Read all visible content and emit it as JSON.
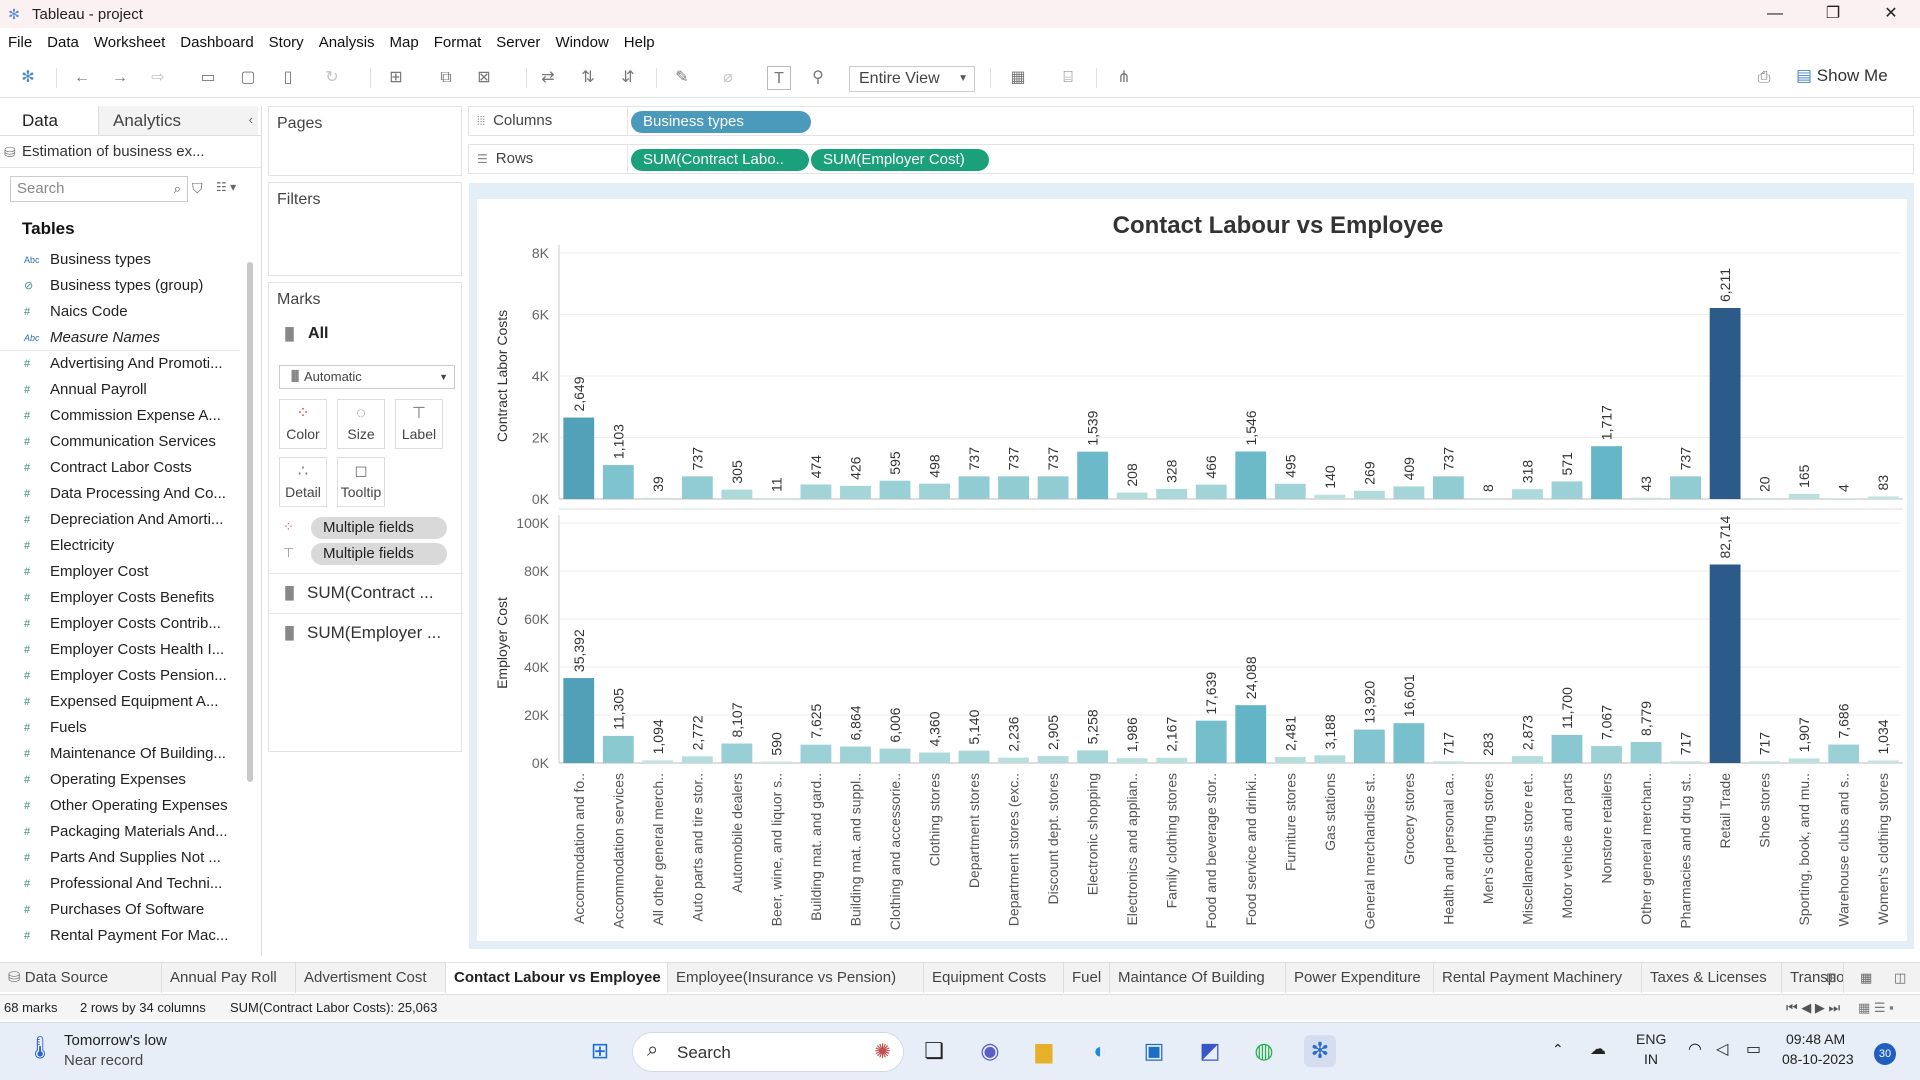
{
  "window": {
    "title": "Tableau - project"
  },
  "menu": [
    "File",
    "Data",
    "Worksheet",
    "Dashboard",
    "Story",
    "Analysis",
    "Map",
    "Format",
    "Server",
    "Window",
    "Help"
  ],
  "toolbar": {
    "fit": "Entire View",
    "show_me": "Show Me"
  },
  "left": {
    "tabs": [
      "Data",
      "Analytics"
    ],
    "datasource": "Estimation of business ex...",
    "search_placeholder": "Search",
    "tables_header": "Tables",
    "fields": [
      {
        "name": "Business types",
        "type": "abc"
      },
      {
        "name": "Business types (group)",
        "type": "group"
      },
      {
        "name": "Naics Code",
        "type": "num"
      },
      {
        "name": "Measure Names",
        "type": "abc",
        "italic": true
      },
      {
        "name": "Advertising And Promoti...",
        "type": "num"
      },
      {
        "name": "Annual Payroll",
        "type": "num"
      },
      {
        "name": "Commission Expense A...",
        "type": "num"
      },
      {
        "name": "Communication Services",
        "type": "num"
      },
      {
        "name": "Contract Labor Costs",
        "type": "num"
      },
      {
        "name": "Data Processing And Co...",
        "type": "num"
      },
      {
        "name": "Depreciation And Amorti...",
        "type": "num"
      },
      {
        "name": "Electricity",
        "type": "num"
      },
      {
        "name": "Employer Cost",
        "type": "num"
      },
      {
        "name": "Employer Costs Benefits",
        "type": "num"
      },
      {
        "name": "Employer Costs Contrib...",
        "type": "num"
      },
      {
        "name": "Employer Costs Health I...",
        "type": "num"
      },
      {
        "name": "Employer Costs Pension...",
        "type": "num"
      },
      {
        "name": "Expensed Equipment A...",
        "type": "num"
      },
      {
        "name": "Fuels",
        "type": "num"
      },
      {
        "name": "Maintenance Of Building...",
        "type": "num"
      },
      {
        "name": "Operating Expenses",
        "type": "num"
      },
      {
        "name": "Other Operating Expenses",
        "type": "num"
      },
      {
        "name": "Packaging Materials And...",
        "type": "num"
      },
      {
        "name": "Parts And Supplies Not ...",
        "type": "num"
      },
      {
        "name": "Professional And Techni...",
        "type": "num"
      },
      {
        "name": "Purchases Of Software",
        "type": "num"
      },
      {
        "name": "Rental Payment For Mac...",
        "type": "num"
      }
    ]
  },
  "cards": {
    "pages": "Pages",
    "filters": "Filters",
    "marks": "Marks",
    "marks_all": "All",
    "mark_type": "Automatic",
    "buttons": [
      "Color",
      "Size",
      "Label",
      "Detail",
      "Tooltip"
    ],
    "pill_color": "Multiple fields",
    "pill_label": "Multiple fields",
    "sum1": "SUM(Contract ...",
    "sum2": "SUM(Employer ..."
  },
  "shelves": {
    "columns_label": "Columns",
    "rows_label": "Rows",
    "columns_pill": "Business types",
    "rows_pills": [
      "SUM(Contract Labo..",
      "SUM(Employer Cost)"
    ]
  },
  "chart_data": {
    "type": "bar",
    "title": "Contact Labour vs Employee",
    "categories": [
      "Accommodation and fo..",
      "Accommodation services",
      "All other general merch..",
      "Auto parts and tire stor..",
      "Automobile dealers",
      "Beer, wine, and liquor s..",
      "Building mat. and gard..",
      "Building mat. and suppl..",
      "Clothing and accessorie..",
      "Clothing stores",
      "Department stores",
      "Department stores (exc..",
      "Discount dept. stores",
      "Electronic shopping",
      "Electronics and applian..",
      "Family clothing stores",
      "Food and beverage stor..",
      "Food service and drinki..",
      "Furniture stores",
      "Gas stations",
      "General merchandise st..",
      "Grocery stores",
      "Health and personal ca..",
      "Men's clothing stores",
      "Miscellaneous store ret..",
      "Motor vehicle and parts",
      "Nonstore retailers",
      "Other general merchan..",
      "Pharmacies and drug st..",
      "Retail Trade",
      "Shoe stores",
      "Sporting, book, and mu..",
      "Warehouse clubs and s..",
      "Women's clothing stores"
    ],
    "series": [
      {
        "name": "Contract Labor Costs",
        "ylim": [
          0,
          8000
        ],
        "ticks": [
          "0K",
          "2K",
          "4K",
          "6K",
          "8K"
        ],
        "tick_values": [
          0,
          2000,
          4000,
          6000,
          8000
        ],
        "values": [
          2649,
          1103,
          39,
          737,
          305,
          11,
          474,
          426,
          595,
          498,
          737,
          737,
          737,
          1539,
          208,
          328,
          466,
          1546,
          495,
          140,
          269,
          409,
          737,
          8,
          318,
          571,
          1717,
          43,
          737,
          6211,
          20,
          165,
          4,
          83
        ],
        "labels": [
          "2,649",
          "1,103",
          "39",
          "737",
          "305",
          "11",
          "474",
          "426",
          "595",
          "498",
          "737",
          "737",
          "737",
          "1,539",
          "208",
          "328",
          "466",
          "1,546",
          "495",
          "140",
          "269",
          "409",
          "737",
          "8",
          "318",
          "571",
          "1,717",
          "43",
          "737",
          "6,211",
          "20",
          "165",
          "4",
          "83"
        ]
      },
      {
        "name": "Employer Cost",
        "ylim": [
          0,
          100000
        ],
        "ticks": [
          "0K",
          "20K",
          "40K",
          "60K",
          "80K",
          "100K"
        ],
        "tick_values": [
          0,
          20000,
          40000,
          60000,
          80000,
          100000
        ],
        "values": [
          35392,
          11305,
          1094,
          2772,
          8107,
          590,
          7625,
          6864,
          6006,
          4360,
          5140,
          2236,
          2905,
          5258,
          1986,
          2167,
          17639,
          24088,
          2481,
          3188,
          13920,
          16601,
          717,
          283,
          2873,
          11700,
          7067,
          8779,
          717,
          82714,
          717,
          1907,
          7686,
          1034
        ],
        "labels": [
          "35,392",
          "11,305",
          "1,094",
          "2,772",
          "8,107",
          "590",
          "7,625",
          "6,864",
          "6,006",
          "4,360",
          "5,140",
          "2,236",
          "2,905",
          "5,258",
          "1,986",
          "2,167",
          "17,639",
          "24,088",
          "2,481",
          "3,188",
          "13,920",
          "16,601",
          "717",
          "283",
          "2,873",
          "11,700",
          "7,067",
          "8,779",
          "717",
          "82,714",
          "717",
          "1,907",
          "7,686",
          "1,034"
        ]
      }
    ],
    "color_min": "#d4ece6",
    "color_mid": "#5cb2c4",
    "color_max": "#2c5b8a"
  },
  "sheet_tabs": {
    "data_source": "Data Source",
    "tabs": [
      "Annual Pay Roll",
      "Advertisment Cost",
      "Contact Labour vs Employee",
      "Employee(Insurance vs Pension)",
      "Equipment Costs",
      "Fuel",
      "Maintance Of Building",
      "Power Expenditure",
      "Rental Payment Machinery",
      "Taxes & Licenses",
      "Transpo"
    ],
    "active": "Contact Labour vs Employee"
  },
  "status": {
    "marks": "68 marks",
    "layout": "2 rows by 34 columns",
    "sum": "SUM(Contract Labor Costs): 25,063"
  },
  "taskbar": {
    "weather_line1": "Tomorrow's low",
    "weather_line2": "Near record",
    "search": "Search",
    "lang1": "ENG",
    "lang2": "IN",
    "time": "09:48 AM",
    "date": "08-10-2023",
    "badge": "30"
  }
}
